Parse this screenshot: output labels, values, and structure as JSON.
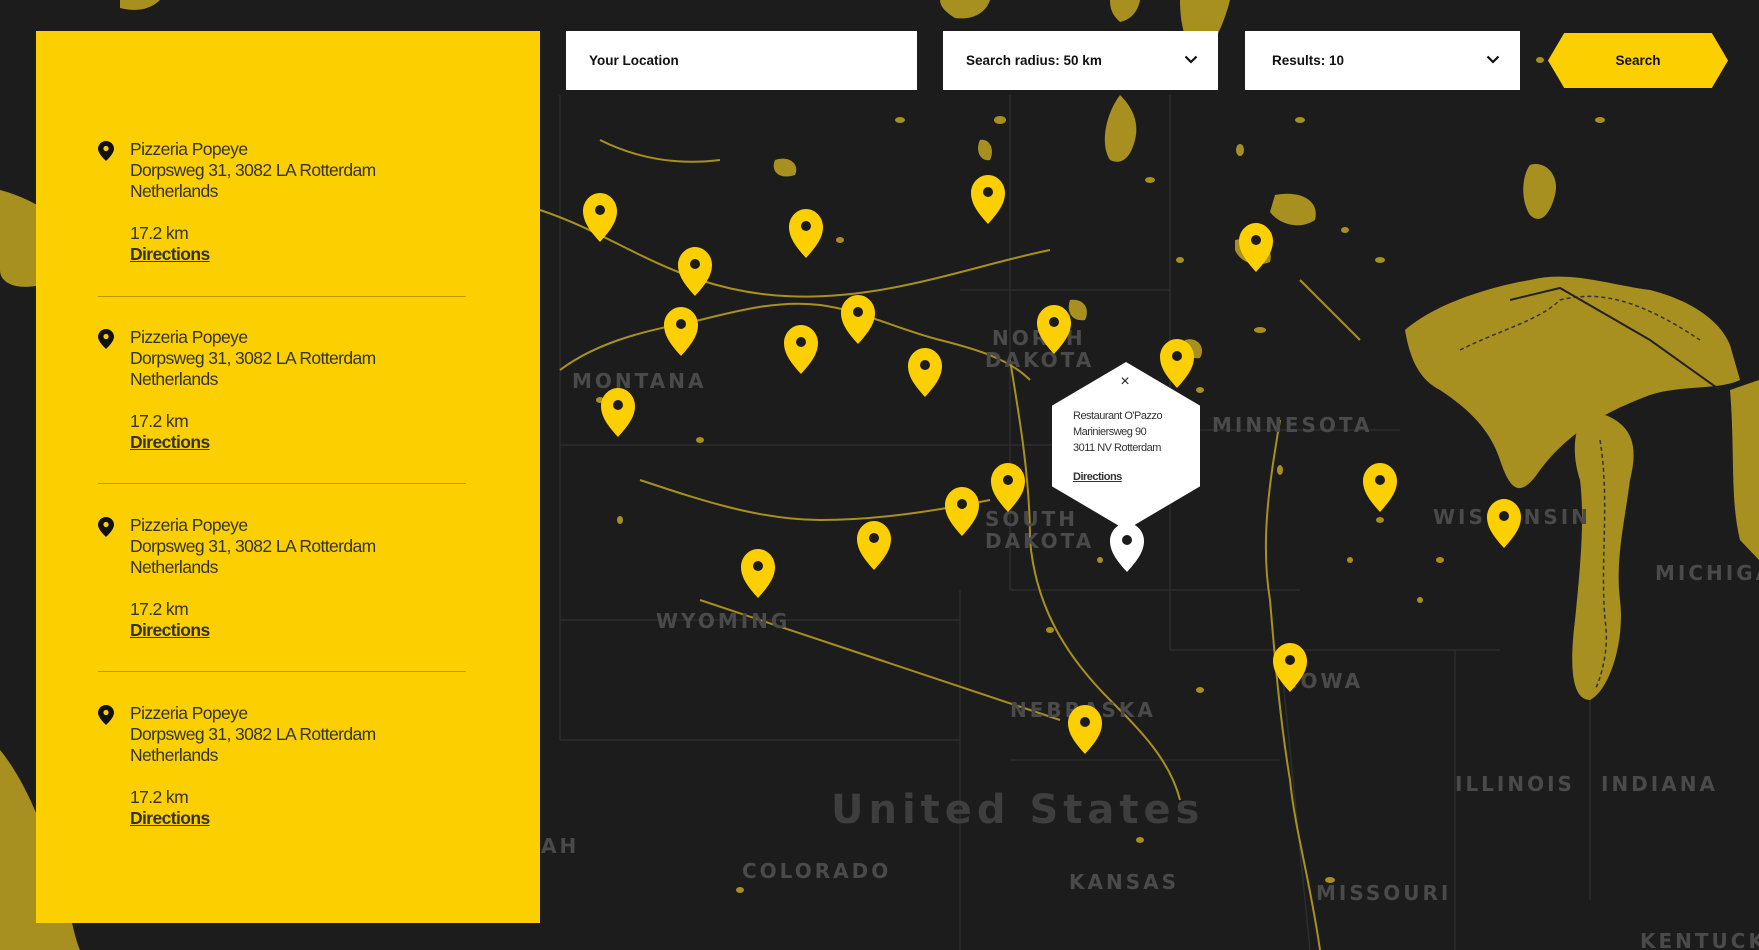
{
  "search": {
    "location_placeholder": "Your Location",
    "radius_label": "Search radius: 50 km",
    "results_label": "Results: 10",
    "button_label": "Search"
  },
  "locations": [
    {
      "name": "Pizzeria Popeye",
      "address": "Dorpsweg 31, 3082 LA Rotterdam",
      "country": "Netherlands",
      "distance": "17.2 km",
      "directions": "Directions"
    },
    {
      "name": "Pizzeria Popeye",
      "address": "Dorpsweg 31, 3082 LA Rotterdam",
      "country": "Netherlands",
      "distance": "17.2 km",
      "directions": "Directions"
    },
    {
      "name": "Pizzeria Popeye",
      "address": "Dorpsweg 31, 3082 LA Rotterdam",
      "country": "Netherlands",
      "distance": "17.2 km",
      "directions": "Directions"
    },
    {
      "name": "Pizzeria Popeye",
      "address": "Dorpsweg 31, 3082 LA Rotterdam",
      "country": "Netherlands",
      "distance": "17.2 km",
      "directions": "Directions"
    }
  ],
  "popup": {
    "close": "×",
    "name": "Restaurant O'Pazzo",
    "street": "Mariniersweg 90",
    "city": "3011 NV Rotterdam",
    "directions": "Directions"
  },
  "map_labels": {
    "montana": "MONTANA",
    "north_dakota_1": "NORTH",
    "north_dakota_2": "DAKOTA",
    "minnesota": "MINNESOTA",
    "south_dakota_1": "SOUTH",
    "south_dakota_2": "DAKOTA",
    "wisconsin": "WISCONSIN",
    "michigan": "MICHIGA",
    "wyoming": "WYOMING",
    "iowa": "IOWA",
    "nebraska": "NEBRASKA",
    "illinois": "ILLINOIS",
    "indiana": "INDIANA",
    "united_states": "United States",
    "colorado": "COLORADO",
    "kansas": "KANSAS",
    "missouri": "MISSOURI",
    "kentucky": "KENTUCKY",
    "utah_fragment": "AH"
  },
  "colors": {
    "accent": "#fcd000",
    "water": "#a89020",
    "land": "#1c1c1c",
    "active_marker": "#ffffff"
  },
  "icons": {
    "location_pin": "map-pin-icon",
    "chevron": "chevron-down-icon",
    "close": "close-icon"
  }
}
